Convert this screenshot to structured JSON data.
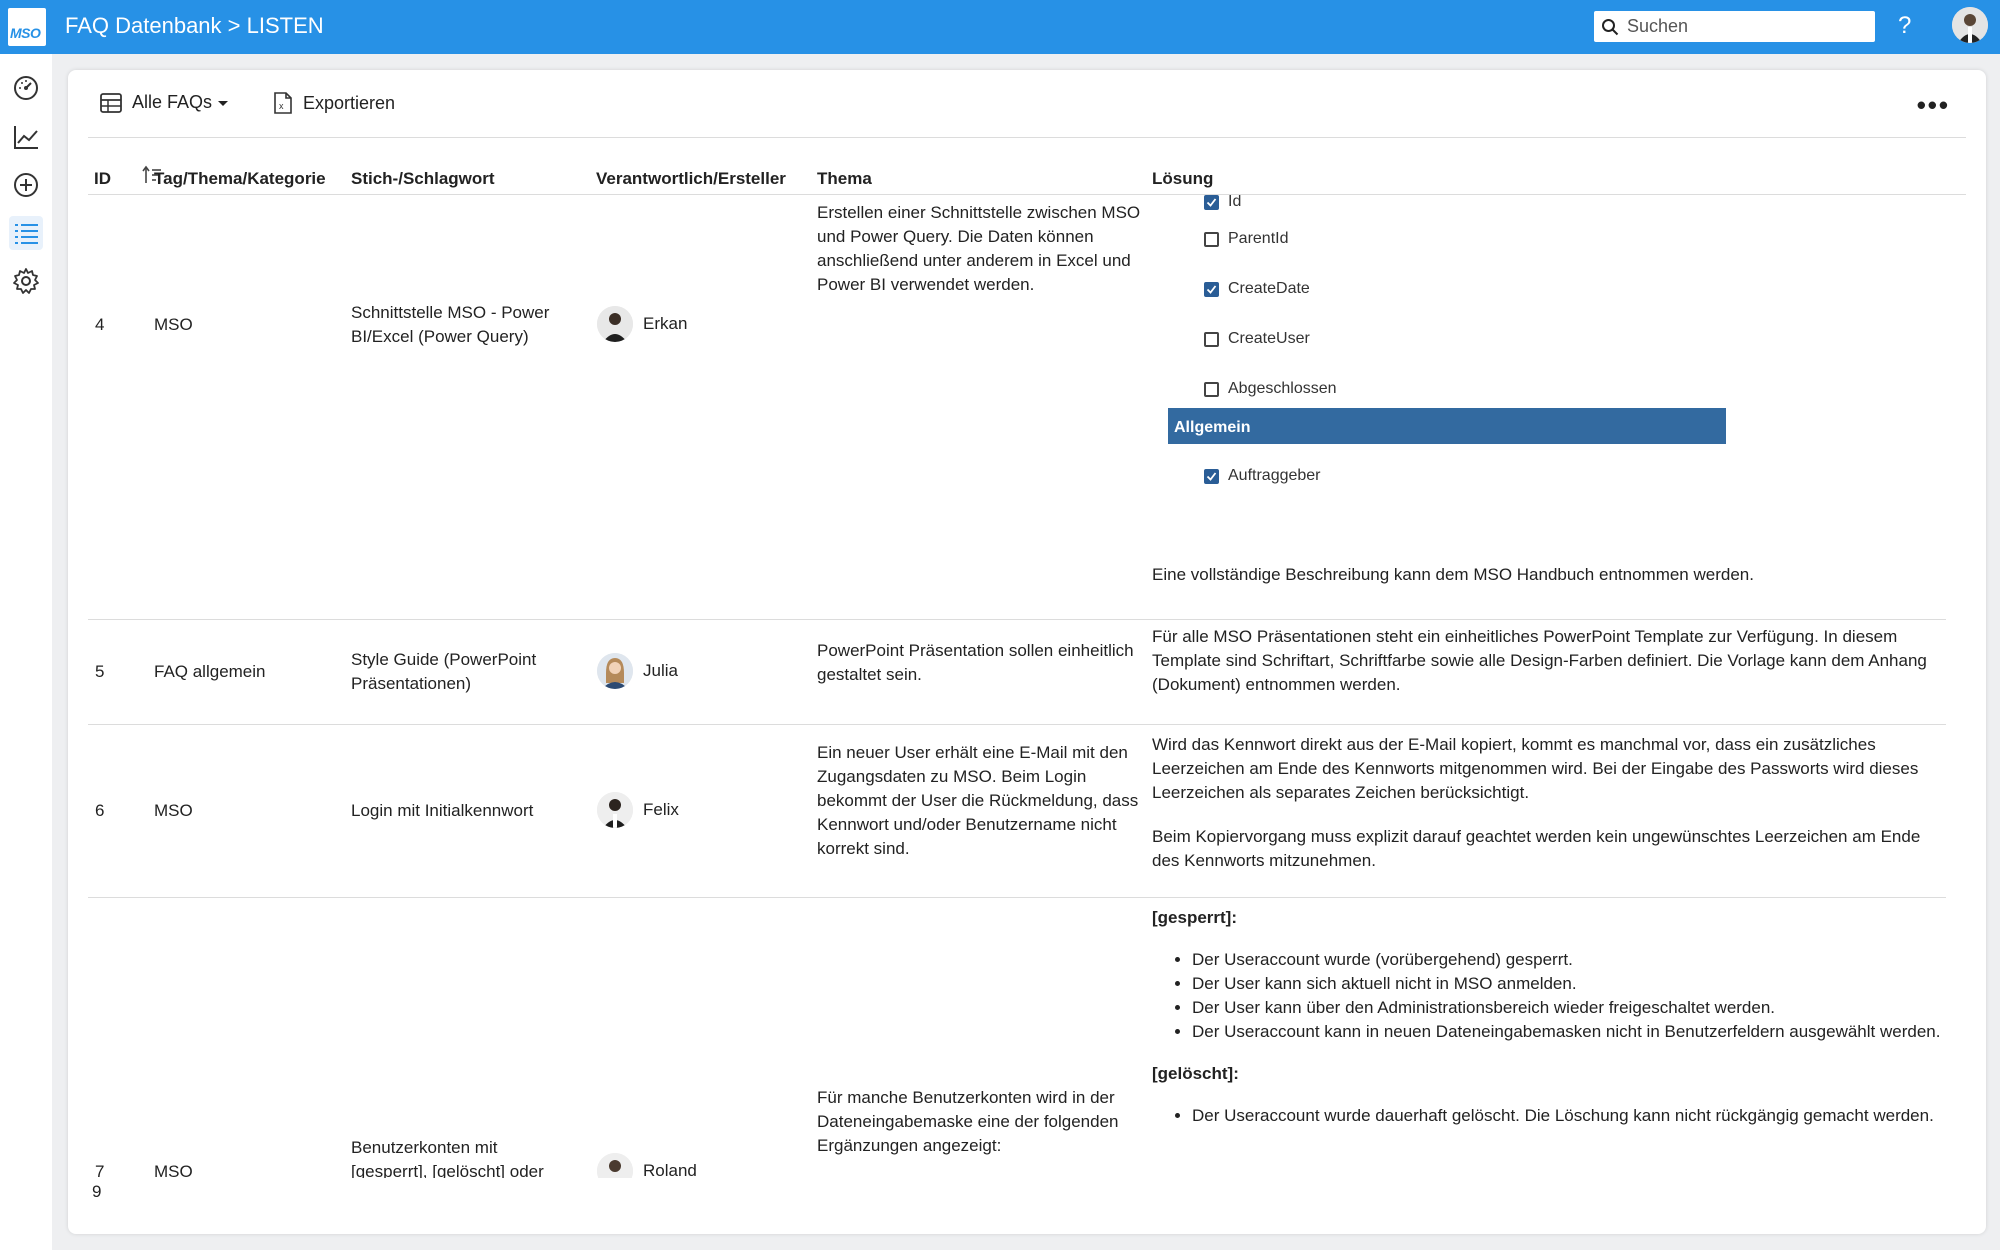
{
  "header": {
    "logo_text": "MSO",
    "title": "FAQ Datenbank > LISTEN",
    "search_placeholder": "Suchen",
    "help_label": "?"
  },
  "toolbar": {
    "view_label": "Alle FAQs",
    "export_label": "Exportieren",
    "more_label": "•••"
  },
  "columns": {
    "id": "ID",
    "tag": "Tag/Thema/Kategorie",
    "keyword": "Stich-/Schlagwort",
    "owner": "Verantwortlich/Ersteller",
    "topic": "Thema",
    "solution": "Lösung"
  },
  "rows": [
    {
      "id": "4",
      "tag": "MSO",
      "keyword": "Schnittstelle MSO - Power BI/Excel (Power Query)",
      "owner": "Erkan",
      "topic": "Erstellen einer Schnittstelle zwischen MSO und Power Query. Die Daten können anschließend unter anderem in Excel und Power BI verwendet werden.",
      "solution_fields": [
        {
          "label": "Id",
          "checked": true
        },
        {
          "label": "ParentId",
          "checked": false
        },
        {
          "label": "CreateDate",
          "checked": true
        },
        {
          "label": "CreateUser",
          "checked": false
        },
        {
          "label": "Abgeschlossen",
          "checked": false
        }
      ],
      "solution_section": "Allgemein",
      "solution_section_fields": [
        {
          "label": "Auftraggeber",
          "checked": true
        }
      ],
      "solution_note": "Eine vollständige Beschreibung kann dem MSO Handbuch entnommen werden."
    },
    {
      "id": "5",
      "tag": "FAQ allgemein",
      "keyword": "Style Guide (PowerPoint Präsentationen)",
      "owner": "Julia",
      "topic": "PowerPoint Präsentation sollen einheitlich gestaltet sein.",
      "solution": "Für alle MSO Präsentationen steht ein einheitliches PowerPoint Template zur Verfügung. In diesem Template sind Schriftart, Schriftfarbe sowie alle Design-Farben definiert. Die Vorlage kann dem Anhang (Dokument) entnommen werden."
    },
    {
      "id": "6",
      "tag": "MSO",
      "keyword": "Login mit Initialkennwort",
      "owner": "Felix",
      "topic": "Ein neuer User erhält eine E-Mail mit den Zugangsdaten zu MSO. Beim Login bekommt der User die Rückmeldung, dass Kennwort und/oder Benutzername nicht korrekt sind.",
      "solution_p1": "Wird das Kennwort direkt aus der E-Mail kopiert, kommt es manchmal vor, dass ein zusätzliches Leerzeichen am Ende des Kennworts mitgenommen wird. Bei der Eingabe des Passworts wird dieses Leerzeichen als separates Zeichen berücksichtigt.",
      "solution_p2": "Beim Kopiervorgang muss explizit darauf geachtet werden kein ungewünschtes Leerzeichen am Ende des Kennworts mitzunehmen."
    },
    {
      "id": "7",
      "tag": "MSO",
      "keyword": "Benutzerkonten mit [gesperrt], [gelöscht] oder",
      "owner": "Roland",
      "topic": "Für manche Benutzerkonten wird in der Dateneingabemaske eine der folgenden Ergänzungen angezeigt:",
      "solution_h1": "[gesperrt]:",
      "solution_list1": [
        "Der Useraccount wurde (vorübergehend) gesperrt.",
        "Der User kann sich aktuell nicht in MSO anmelden.",
        "Der User kann über den Administrationsbereich wieder freigeschaltet werden.",
        "Der Useraccount kann in neuen Dateneingabemasken nicht in Benutzerfeldern ausgewählt werden."
      ],
      "solution_h2": "[gelöscht]:",
      "solution_list2": [
        "Der Useraccount wurde dauerhaft gelöscht. Die Löschung kann nicht rückgängig gemacht werden."
      ]
    }
  ],
  "footer": {
    "count": "9"
  }
}
